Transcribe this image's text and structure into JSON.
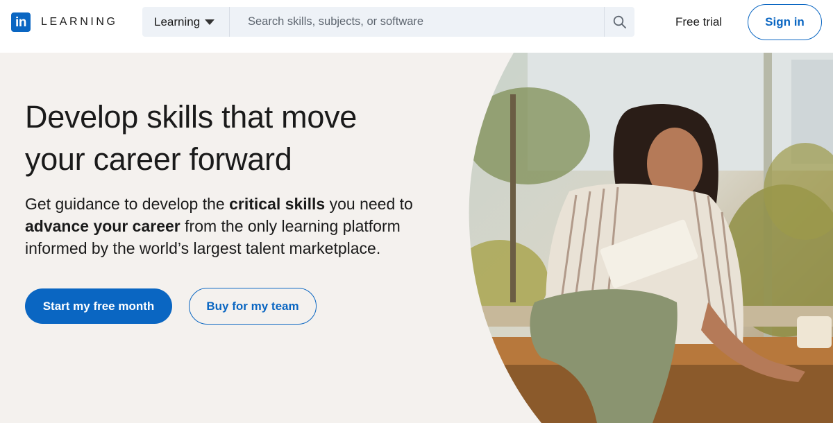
{
  "header": {
    "logo_mark": "in",
    "logo_text": "LEARNING",
    "search_scope": "Learning",
    "search_placeholder": "Search skills, subjects, or software",
    "free_trial": "Free trial",
    "sign_in": "Sign in"
  },
  "hero": {
    "headline_line1": "Develop skills that move",
    "headline_line2": "your career forward",
    "sub_part1": "Get guidance to develop the ",
    "sub_bold1": "critical skills",
    "sub_part2": " you need to",
    "sub_bold2": "advance your career",
    "sub_part3": " from the only learning platform",
    "sub_line3": "informed by the world’s largest talent marketplace.",
    "primary_cta": "Start my free month",
    "secondary_cta": "Buy for my team"
  },
  "colors": {
    "brand_blue": "#0a66c2",
    "hero_background": "#f4f1ee",
    "search_background": "#eef2f7"
  },
  "icons": [
    "linkedin-logo-icon",
    "caret-down-icon",
    "search-icon"
  ]
}
